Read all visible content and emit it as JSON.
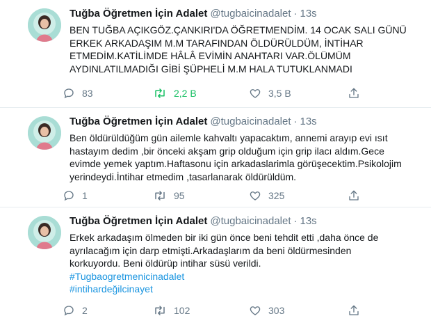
{
  "tweets": [
    {
      "name": "Tuğba Öğretmen İçin Adalet",
      "handle": "@tugbaicinadalet",
      "separator": "·",
      "time": "13s",
      "lines": [
        "BEN TUĞBA AÇIKGÖZ.ÇANKIRI'DA ÖĞRETMENDİM. 14 OCAK SALI GÜNÜ",
        "ERKEK ARKADAŞIM M.M TARAFINDAN  ÖLDÜRÜLDÜM, İNTİHAR",
        "ETMEDİM.KATİLİMDE HÂLÂ EVİMİN ANAHTARI VAR.ÖLÜMÜM",
        "AYDINLATILMADIĞI GİBİ ŞÜPHELİ M.M HALA TUTUKLANMADI"
      ],
      "hashtags": [],
      "reply_count": "83",
      "retweet_count": "2,2 B",
      "like_count": "3,5 B",
      "retweeted": true
    },
    {
      "name": "Tuğba Öğretmen İçin Adalet",
      "handle": "@tugbaicinadalet",
      "separator": "·",
      "time": "13s",
      "lines": [
        "Ben öldürüldüğüm gün ailemle kahvaltı yapacaktım, annemi arayıp evi ısıt",
        "hastayım dedim ,bir önceki akşam grip olduğum için grip ilacı aldım.Gece",
        "evimde yemek yaptım.Haftasonu için arkadaslarimla görüşecektim.Psikolojim",
        "yerindeydi.İntihar etmedim ,tasarlanarak öldürüldüm."
      ],
      "hashtags": [],
      "reply_count": "1",
      "retweet_count": "95",
      "like_count": "325",
      "retweeted": false
    },
    {
      "name": "Tuğba Öğretmen İçin Adalet",
      "handle": "@tugbaicinadalet",
      "separator": "·",
      "time": "13s",
      "lines": [
        "Erkek arkadaşım ölmeden bir iki gün önce beni tehdit etti ,daha önce de",
        "ayrılacağım için darp etmişti.Arkadaşlarım da beni öldürmesinden",
        "korkuyordu. Beni öldürüp intihar süsü verildi."
      ],
      "hashtags": [
        "#Tugbaogretmenicinadalet",
        "#intihardeğilcinayet"
      ],
      "reply_count": "2",
      "retweet_count": "102",
      "like_count": "303",
      "retweeted": false
    }
  ],
  "icons": {
    "reply": "reply-icon",
    "retweet": "retweet-icon",
    "like": "heart-icon",
    "share": "share-icon"
  },
  "colors": {
    "text": "#14171a",
    "secondary": "#657786",
    "link": "#1b95e0",
    "retweet_active": "#17bf63",
    "divider": "#e6ecf0"
  }
}
